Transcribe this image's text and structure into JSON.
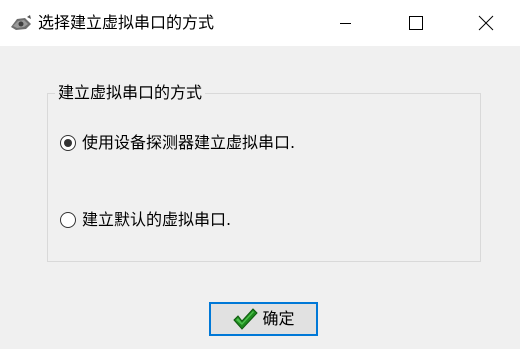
{
  "window": {
    "title": "选择建立虚拟串口的方式",
    "icon": "app-gear-icon",
    "controls": [
      "minimize-icon",
      "maximize-icon",
      "close-icon"
    ]
  },
  "group": {
    "legend": "建立虚拟串口的方式"
  },
  "options": [
    {
      "label": "使用设备探测器建立虚拟串口.",
      "selected": true
    },
    {
      "label": "建立默认的虚拟串口.",
      "selected": false
    }
  ],
  "ok_button": {
    "label": "确定",
    "icon": "checkmark-icon"
  },
  "colors": {
    "titlebar_bg": "#ffffff",
    "window_bg": "#f0f0f0",
    "focus_border": "#0078d7",
    "check_green": "#1e8a1e"
  }
}
